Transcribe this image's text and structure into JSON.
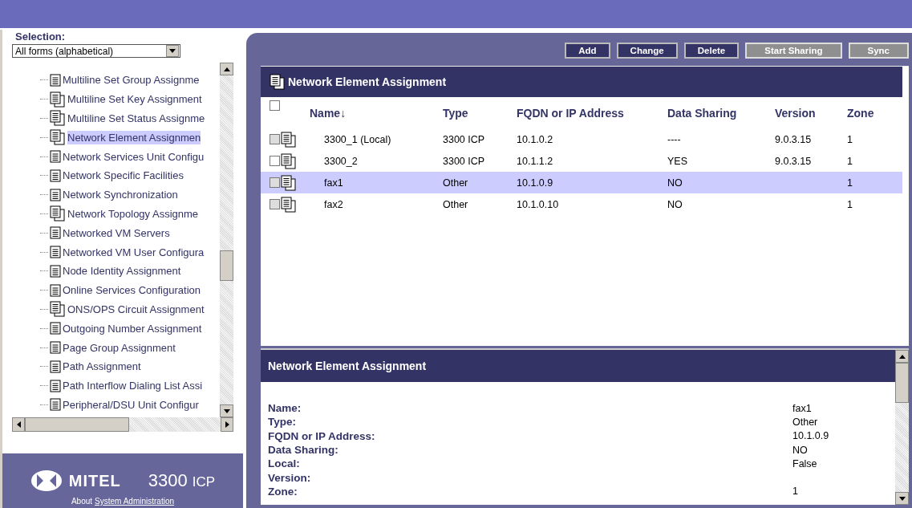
{
  "sidebar": {
    "selection_label": "Selection:",
    "dropdown": {
      "value": "All forms (alphabetical)"
    },
    "items": [
      {
        "label": "Multiline Set Group Assignme",
        "kind": "single",
        "selected": false
      },
      {
        "label": "Multiline Set Key Assignment",
        "kind": "multi",
        "selected": false
      },
      {
        "label": "Multiline Set Status Assignme",
        "kind": "multi",
        "selected": false
      },
      {
        "label": "Network Element Assignmen",
        "kind": "multi",
        "selected": true
      },
      {
        "label": "Network Services Unit Configu",
        "kind": "single",
        "selected": false
      },
      {
        "label": "Network Specific Facilities",
        "kind": "single",
        "selected": false
      },
      {
        "label": "Network Synchronization",
        "kind": "single",
        "selected": false
      },
      {
        "label": "Network Topology Assignme",
        "kind": "multi",
        "selected": false
      },
      {
        "label": "Networked VM Servers",
        "kind": "single",
        "selected": false
      },
      {
        "label": "Networked VM User Configura",
        "kind": "single",
        "selected": false
      },
      {
        "label": "Node Identity Assignment",
        "kind": "single",
        "selected": false
      },
      {
        "label": "Online Services Configuration",
        "kind": "single",
        "selected": false
      },
      {
        "label": "ONS/OPS Circuit Assignment",
        "kind": "multi",
        "selected": false
      },
      {
        "label": "Outgoing Number Assignment",
        "kind": "single",
        "selected": false
      },
      {
        "label": "Page Group Assignment",
        "kind": "single",
        "selected": false
      },
      {
        "label": "Path Assignment",
        "kind": "single",
        "selected": false
      },
      {
        "label": "Path Interflow Dialing List Assi",
        "kind": "single",
        "selected": false
      },
      {
        "label": "Peripheral/DSU Unit Configur",
        "kind": "single",
        "selected": false
      }
    ],
    "brand": {
      "logo": "MITEL",
      "product": "3300",
      "product_suffix": "ICP",
      "about": "About",
      "about_link": "System Administration"
    }
  },
  "toolbar": {
    "buttons": [
      {
        "label": "Add",
        "disabled": false
      },
      {
        "label": "Change",
        "disabled": false
      },
      {
        "label": "Delete",
        "disabled": false
      },
      {
        "label": "Start Sharing",
        "disabled": true
      },
      {
        "label": "Sync",
        "disabled": true
      }
    ]
  },
  "table": {
    "title": "Network Element Assignment",
    "select_all_checked": false,
    "columns": [
      "Name↓",
      "Type",
      "FQDN or IP Address",
      "Data Sharing",
      "Version",
      "Zone"
    ],
    "rows": [
      {
        "disabled": true,
        "checked": false,
        "selected": false,
        "cells": [
          "3300_1 (Local)",
          "3300 ICP",
          "10.1.0.2",
          "----",
          "9.0.3.15",
          "1"
        ]
      },
      {
        "disabled": false,
        "checked": false,
        "selected": false,
        "cells": [
          "3300_2",
          "3300 ICP",
          "10.1.1.2",
          "YES",
          "9.0.3.15",
          "1"
        ]
      },
      {
        "disabled": true,
        "checked": false,
        "selected": true,
        "cells": [
          "fax1",
          "Other",
          "10.1.0.9",
          "NO",
          "",
          "1"
        ]
      },
      {
        "disabled": true,
        "checked": false,
        "selected": false,
        "cells": [
          "fax2",
          "Other",
          "10.1.0.10",
          "NO",
          "",
          "1"
        ]
      }
    ]
  },
  "details": {
    "title": "Network Element Assignment",
    "fields": [
      {
        "label": "Name:",
        "value": "fax1"
      },
      {
        "label": "Type:",
        "value": "Other"
      },
      {
        "label": "FQDN or IP Address:",
        "value": "10.1.0.9"
      },
      {
        "label": "Data Sharing:",
        "value": "NO"
      },
      {
        "label": "Local:",
        "value": "False"
      },
      {
        "label": "Version:"
      },
      {
        "label": "Zone:",
        "value": "1"
      }
    ]
  }
}
